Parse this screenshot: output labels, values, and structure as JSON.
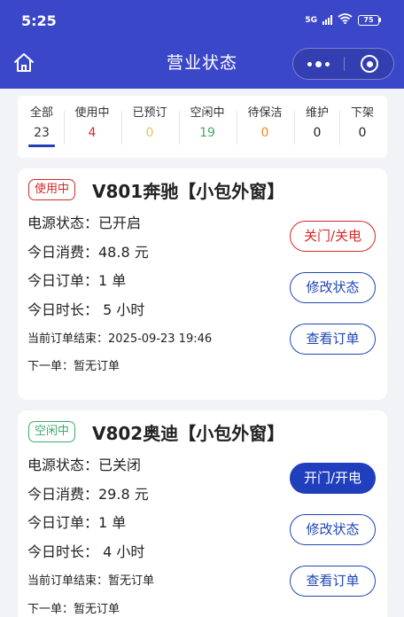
{
  "status_bar": {
    "time": "5:25",
    "network": "5G",
    "battery": "75"
  },
  "nav": {
    "title": "营业状态"
  },
  "tabs": [
    {
      "label": "全部",
      "count": "23",
      "color": "#333333",
      "active": true
    },
    {
      "label": "使用中",
      "count": "4",
      "color": "#d62828",
      "active": false
    },
    {
      "label": "已预订",
      "count": "0",
      "color": "#e6c35a",
      "active": false
    },
    {
      "label": "空闲中",
      "count": "19",
      "color": "#3daa6b",
      "active": false
    },
    {
      "label": "待保洁",
      "count": "0",
      "color": "#ef8a1b",
      "active": false
    },
    {
      "label": "维护",
      "count": "0",
      "color": "#222222",
      "active": false
    },
    {
      "label": "下架",
      "count": "0",
      "color": "#222222",
      "active": false
    }
  ],
  "rooms": [
    {
      "badge": "使用中",
      "badge_color": "#d62828",
      "badge_bg": "#ffffff",
      "title": "V801奔驰【小包外窗】",
      "power": "电源状态：已开启",
      "spend": "今日消费：48.8 元",
      "orders": "今日订单：1 单",
      "duration": "今日时长： 5 小时",
      "current_end": "当前订单结束：2025-09-23 19:46",
      "next": "下一单：暂无订单",
      "actions": {
        "power": "关门/关电",
        "edit": "修改状态",
        "view": "查看订单"
      }
    },
    {
      "badge": "空闲中",
      "badge_color": "#3daa6b",
      "badge_bg": "#ffffff",
      "title": "V802奥迪【小包外窗】",
      "power": "电源状态：已关闭",
      "spend": "今日消费：29.8 元",
      "orders": "今日订单：1 单",
      "duration": "今日时长： 4 小时",
      "current_end": "当前订单结束：暂无订单",
      "next": "下一单：暂无订单",
      "actions": {
        "power": "开门/开电",
        "edit": "修改状态",
        "view": "查看订单"
      }
    }
  ]
}
